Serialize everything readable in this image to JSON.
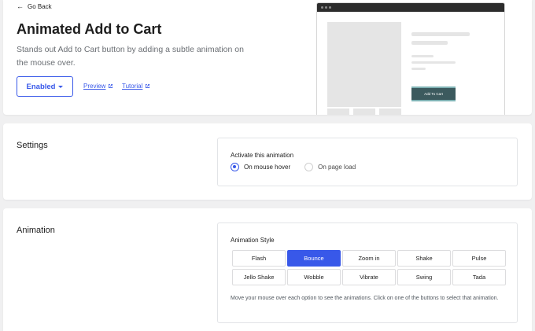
{
  "header": {
    "back_label": "Go Back",
    "title": "Animated Add to Cart",
    "description": "Stands out Add to Cart button by adding a subtle animation on the mouse over.",
    "status_label": "Enabled",
    "preview_label": "Preview",
    "tutorial_label": "Tutorial",
    "mock_button_label": "Add To Cart"
  },
  "settings": {
    "title": "Settings",
    "field_label": "Activate this animation",
    "options": [
      {
        "label": "On mouse hover",
        "checked": true
      },
      {
        "label": "On page load",
        "checked": false
      }
    ]
  },
  "animation": {
    "title": "Animation",
    "field_label": "Animation Style",
    "styles": [
      "Flash",
      "Bounce",
      "Zoom in",
      "Shake",
      "Pulse",
      "Jello Shake",
      "Wobble",
      "Vibrate",
      "Swing",
      "Tada"
    ],
    "selected": "Bounce",
    "help_text": "Move your mouse over each option to see the animations. Click on one of the buttons to select that animation."
  },
  "colors": {
    "accent": "#3858e9",
    "page_bg": "#f0f0f1",
    "mock_cart_bg": "#3c5a5e"
  }
}
